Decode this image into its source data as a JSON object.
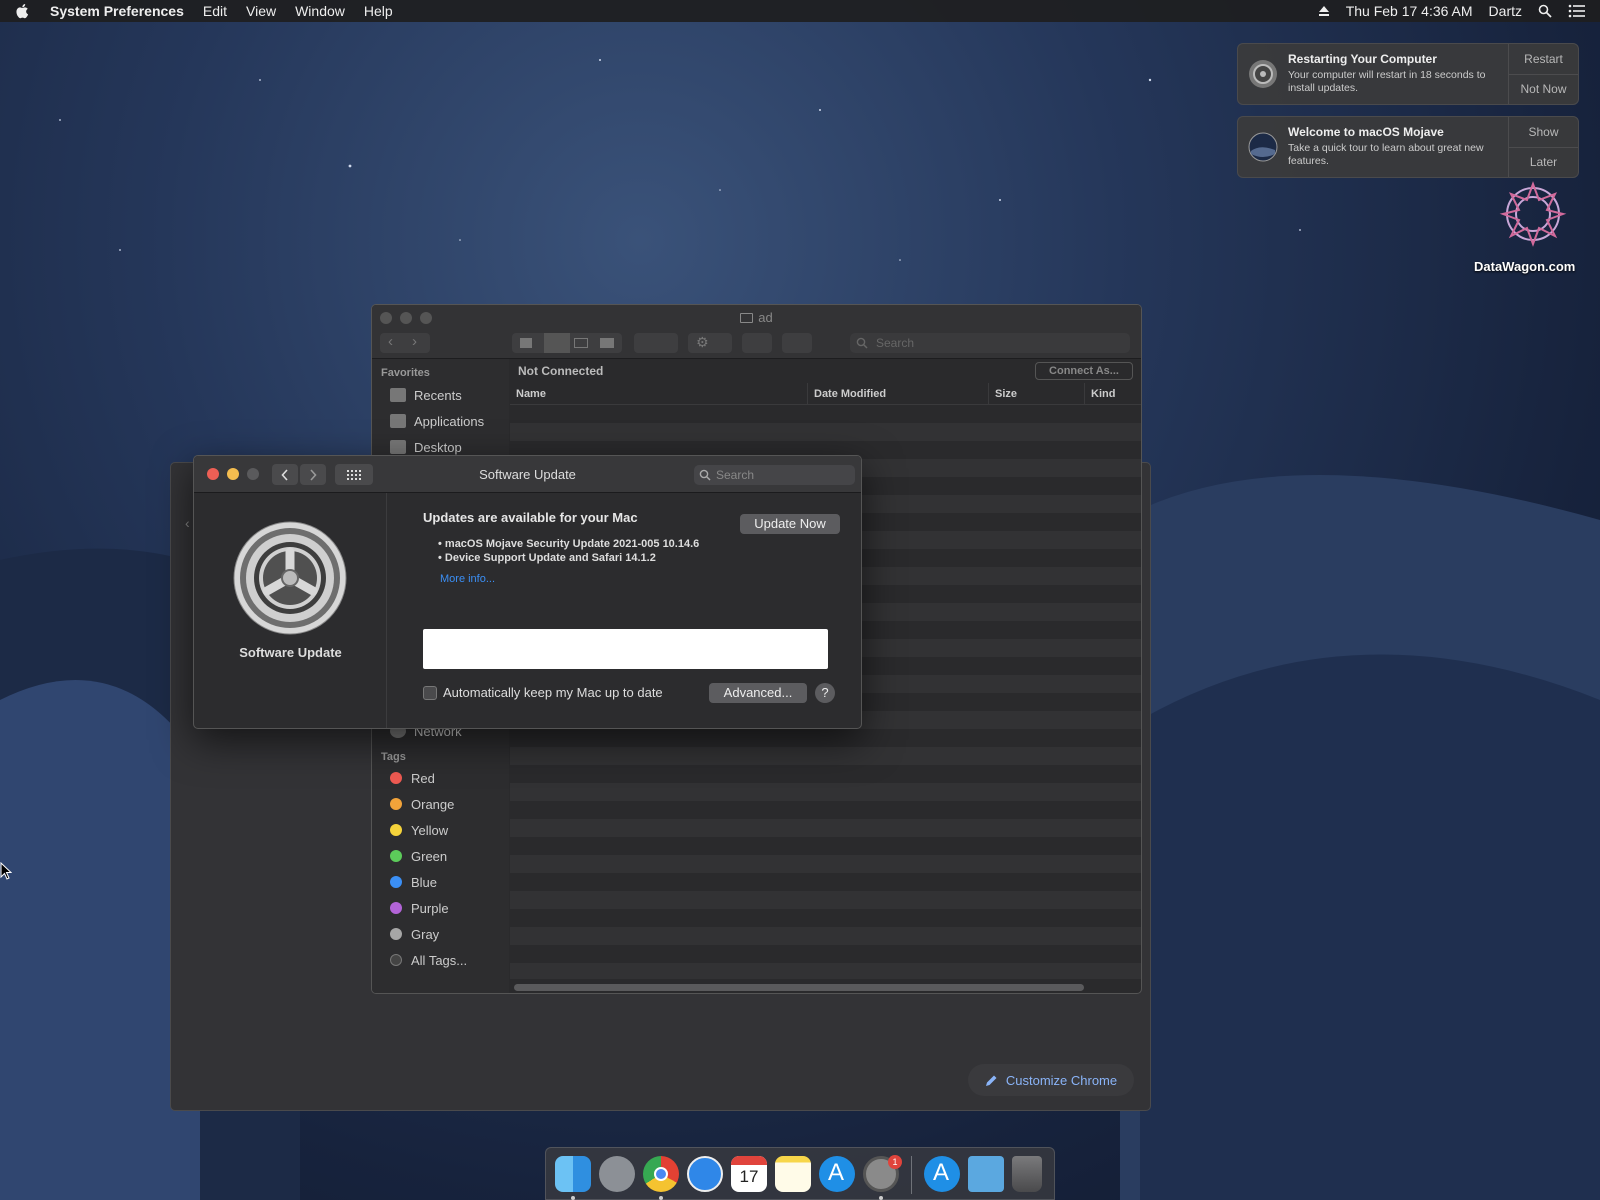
{
  "menubar": {
    "app_name": "System Preferences",
    "items": [
      "Edit",
      "View",
      "Window",
      "Help"
    ],
    "datetime": "Thu Feb 17  4:36 AM",
    "user": "Dartz"
  },
  "notifications": [
    {
      "title": "Restarting Your Computer",
      "text": "Your computer will restart in 18 seconds to install updates.",
      "actions": [
        "Restart",
        "Not Now"
      ]
    },
    {
      "title": "Welcome to macOS Mojave",
      "text": "Take a quick tour to learn about great new features.",
      "actions": [
        "Show",
        "Later"
      ]
    }
  ],
  "desktop": {
    "item_label": "DataWagon.com"
  },
  "finder": {
    "title": "ad",
    "search_placeholder": "Search",
    "favorites_header": "Favorites",
    "favorites": [
      "Recents",
      "Applications",
      "Desktop"
    ],
    "network_item": "Network",
    "tags_header": "Tags",
    "tags": [
      {
        "name": "Red",
        "color": "#ee5a52"
      },
      {
        "name": "Orange",
        "color": "#f2a33a"
      },
      {
        "name": "Yellow",
        "color": "#f5d33b"
      },
      {
        "name": "Green",
        "color": "#5ccb5a"
      },
      {
        "name": "Blue",
        "color": "#3b8ff5"
      },
      {
        "name": "Purple",
        "color": "#b364d8"
      },
      {
        "name": "Gray",
        "color": "#a6a6a6"
      }
    ],
    "all_tags": "All Tags...",
    "status": "Not Connected",
    "connect_button": "Connect As...",
    "columns": [
      "Name",
      "Date Modified",
      "Size",
      "Kind"
    ]
  },
  "software_update": {
    "window_title": "Software Update",
    "search_placeholder": "Search",
    "pane_label": "Software Update",
    "heading": "Updates are available for your Mac",
    "update_button": "Update Now",
    "updates": [
      "• macOS Mojave Security Update 2021-005 10.14.6",
      "• Device Support Update  and Safari 14.1.2"
    ],
    "more_info": "More info...",
    "auto_update_label": "Automatically keep my Mac up to date",
    "advanced_button": "Advanced...",
    "help_button": "?"
  },
  "chrome": {
    "customize_button": "Customize Chrome"
  },
  "dock": {
    "calendar_day": "17",
    "sysprefs_badge": "1"
  },
  "colors": {
    "close": "#ed5f55",
    "minimize": "#f4bd4f",
    "link": "#3b8ff5"
  }
}
